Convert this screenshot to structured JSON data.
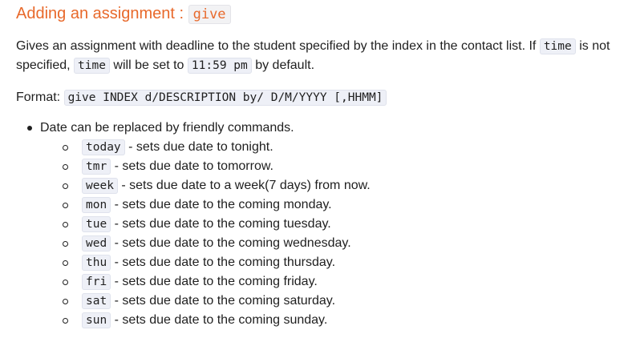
{
  "heading": {
    "text": "Adding an assignment : ",
    "command": "give"
  },
  "description": {
    "part1": "Gives an assignment with deadline to the student specified by the index in the contact list. If ",
    "code1": "time",
    "part2": " is not specified, ",
    "code2": "time",
    "part3": " will be set to ",
    "code3": "11:59 pm",
    "part4": " by default."
  },
  "format": {
    "label": "Format: ",
    "code": "give INDEX d/DESCRIPTION by/ D/M/YYYY [,HHMM]"
  },
  "bullet": {
    "text": "Date can be replaced by friendly commands."
  },
  "commands": [
    {
      "code": "today",
      "text": " - sets due date to tonight."
    },
    {
      "code": "tmr",
      "text": " - sets due date to tomorrow."
    },
    {
      "code": "week",
      "text": " - sets due date to a week(7 days) from now."
    },
    {
      "code": "mon",
      "text": " - sets due date to the coming monday."
    },
    {
      "code": "tue",
      "text": " - sets due date to the coming tuesday."
    },
    {
      "code": "wed",
      "text": " - sets due date to the coming wednesday."
    },
    {
      "code": "thu",
      "text": " - sets due date to the coming thursday."
    },
    {
      "code": "fri",
      "text": " - sets due date to the coming friday."
    },
    {
      "code": "sat",
      "text": " - sets due date to the coming saturday."
    },
    {
      "code": "sun",
      "text": " - sets due date to the coming sunday."
    }
  ],
  "colors": {
    "heading": "#e8692b",
    "code_background": "#eef0f7",
    "text": "#1f1f1f"
  }
}
